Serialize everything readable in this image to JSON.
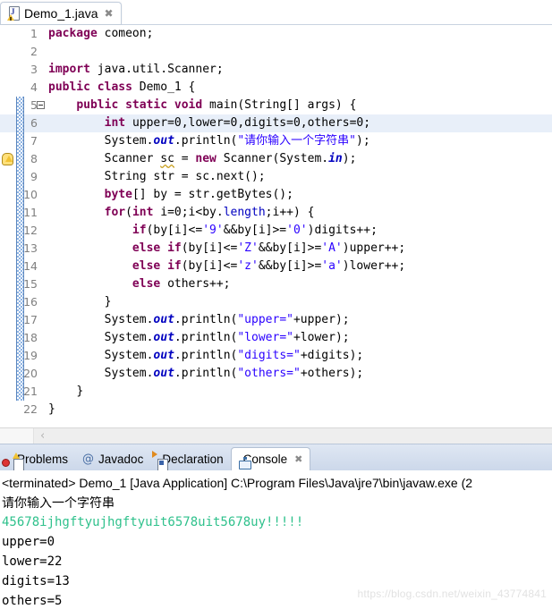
{
  "editor": {
    "tab": {
      "title": "Demo_1.java",
      "close_glyph": "✖",
      "icon": "java-file-warning-icon"
    },
    "lines": [
      {
        "no": "1",
        "html": "<span class=\"kw\">package</span> <span class=\"pln\">comeon;</span>"
      },
      {
        "no": "2",
        "html": ""
      },
      {
        "no": "3",
        "html": "<span class=\"kw\">import</span> <span class=\"pln\">java.util.Scanner;</span>"
      },
      {
        "no": "4",
        "html": "<span class=\"kw\">public</span> <span class=\"kw\">class</span> <span class=\"pln\">Demo_1 {</span>"
      },
      {
        "no": "5",
        "html": "    <span class=\"kw\">public</span> <span class=\"kw\">static</span> <span class=\"kw\">void</span> <span class=\"pln\">main(String[] args) {</span>"
      },
      {
        "no": "6",
        "html": "        <span class=\"kw\">int</span> <span class=\"pln\">upper=0,lower=0,digits=0,others=0;</span>"
      },
      {
        "no": "7",
        "html": "        <span class=\"pln\">System.</span><span class=\"fld\">out</span><span class=\"pln\">.println(</span><span class=\"str\">\"请你输入一个字符串\"</span><span class=\"pln\">);</span>"
      },
      {
        "no": "8",
        "html": "        <span class=\"pln\">Scanner </span><span class=\"squig\">sc</span><span class=\"pln\"> = </span><span class=\"kw\">new</span><span class=\"pln\"> Scanner(System.</span><span class=\"fld\">in</span><span class=\"pln\">);</span>"
      },
      {
        "no": "9",
        "html": "        <span class=\"pln\">String str = sc.next();</span>"
      },
      {
        "no": "10",
        "html": "        <span class=\"kw\">byte</span><span class=\"pln\">[] by = str.getBytes();</span>"
      },
      {
        "no": "11",
        "html": "        <span class=\"kw\">for</span><span class=\"pln\">(</span><span class=\"kw\">int</span><span class=\"pln\"> i=0;i&lt;by.</span><span class=\"fld2\">length</span><span class=\"pln\">;i++) {</span>"
      },
      {
        "no": "12",
        "html": "            <span class=\"kw\">if</span><span class=\"pln\">(by[i]&lt;=</span><span class=\"str\">'9'</span><span class=\"pln\">&amp;&amp;by[i]&gt;=</span><span class=\"str\">'0'</span><span class=\"pln\">)digits++;</span>"
      },
      {
        "no": "13",
        "html": "            <span class=\"kw\">else</span> <span class=\"kw\">if</span><span class=\"pln\">(by[i]&lt;=</span><span class=\"str\">'Z'</span><span class=\"pln\">&amp;&amp;by[i]&gt;=</span><span class=\"str\">'A'</span><span class=\"pln\">)upper++;</span>"
      },
      {
        "no": "14",
        "html": "            <span class=\"kw\">else</span> <span class=\"kw\">if</span><span class=\"pln\">(by[i]&lt;=</span><span class=\"str\">'z'</span><span class=\"pln\">&amp;&amp;by[i]&gt;=</span><span class=\"str\">'a'</span><span class=\"pln\">)lower++;</span>"
      },
      {
        "no": "15",
        "html": "            <span class=\"kw\">else</span> <span class=\"pln\">others++;</span>"
      },
      {
        "no": "16",
        "html": "        <span class=\"pln\">}</span>"
      },
      {
        "no": "17",
        "html": "        <span class=\"pln\">System.</span><span class=\"fld\">out</span><span class=\"pln\">.println(</span><span class=\"str\">\"upper=\"</span><span class=\"pln\">+upper);</span>"
      },
      {
        "no": "18",
        "html": "        <span class=\"pln\">System.</span><span class=\"fld\">out</span><span class=\"pln\">.println(</span><span class=\"str\">\"lower=\"</span><span class=\"pln\">+lower);</span>"
      },
      {
        "no": "19",
        "html": "        <span class=\"pln\">System.</span><span class=\"fld\">out</span><span class=\"pln\">.println(</span><span class=\"str\">\"digits=\"</span><span class=\"pln\">+digits);</span>"
      },
      {
        "no": "20",
        "html": "        <span class=\"pln\">System.</span><span class=\"fld\">out</span><span class=\"pln\">.println(</span><span class=\"str\">\"others=\"</span><span class=\"pln\">+others);</span>"
      },
      {
        "no": "21",
        "html": "    <span class=\"pln\">}</span>"
      },
      {
        "no": "22",
        "html": "<span class=\"pln\">}</span>"
      }
    ],
    "scroll_left_arrow": "‹"
  },
  "bottom": {
    "tabs": [
      {
        "label": "Problems",
        "icon": "problems-icon",
        "active": false
      },
      {
        "label": "Javadoc",
        "icon": "javadoc-at-icon",
        "active": false
      },
      {
        "label": "Declaration",
        "icon": "declaration-icon",
        "active": false
      },
      {
        "label": "Console",
        "icon": "console-icon",
        "active": true
      }
    ],
    "close_glyph": "✖"
  },
  "console": {
    "header": "<terminated> Demo_1 [Java Application] C:\\Program Files\\Java\\jre7\\bin\\javaw.exe (2",
    "lines": [
      {
        "text": "请你输入一个字符串",
        "kind": "out"
      },
      {
        "text": "45678ijhgftyujhgftyuit6578uit5678uy!!!!!",
        "kind": "input"
      },
      {
        "text": "upper=0",
        "kind": "mono"
      },
      {
        "text": "lower=22",
        "kind": "mono"
      },
      {
        "text": "digits=13",
        "kind": "mono"
      },
      {
        "text": "others=5",
        "kind": "mono"
      }
    ]
  },
  "watermark": {
    "text": "https://blog.csdn.net/weixin_43774841"
  },
  "colors": {
    "keyword": "#7f0055",
    "string": "#2a00ff",
    "field": "#0000c0",
    "console_input": "#2fc18c",
    "tab_bar": "#ccd8ea"
  }
}
